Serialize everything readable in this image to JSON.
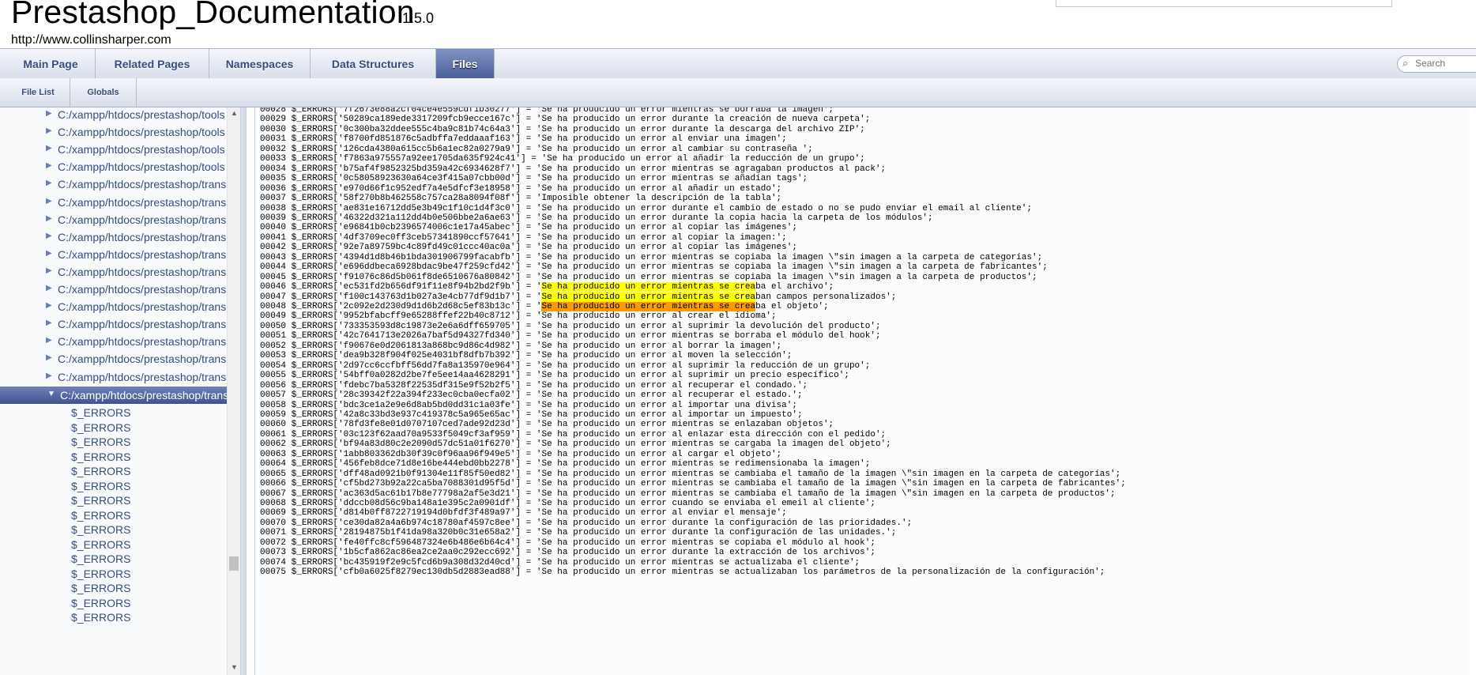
{
  "header": {
    "project_name": "Prestashop_Documentation",
    "project_number": "1.5.0",
    "project_brief": "http://www.collinsharper.com"
  },
  "tabs": [
    {
      "label": "Main Page",
      "current": false
    },
    {
      "label": "Related Pages",
      "current": false
    },
    {
      "label": "Namespaces",
      "current": false
    },
    {
      "label": "Data Structures",
      "current": false
    },
    {
      "label": "Files",
      "current": true
    }
  ],
  "subtabs": [
    {
      "label": "File List"
    },
    {
      "label": "Globals"
    }
  ],
  "search": {
    "placeholder": "Search",
    "icon": "magnifier-icon"
  },
  "tree": {
    "paths": [
      "C:/xampp/htdocs/prestashop/tools",
      "C:/xampp/htdocs/prestashop/tools",
      "C:/xampp/htdocs/prestashop/tools",
      "C:/xampp/htdocs/prestashop/tools",
      "C:/xampp/htdocs/prestashop/translations",
      "C:/xampp/htdocs/prestashop/translations",
      "C:/xampp/htdocs/prestashop/translations",
      "C:/xampp/htdocs/prestashop/translations",
      "C:/xampp/htdocs/prestashop/translations",
      "C:/xampp/htdocs/prestashop/translations",
      "C:/xampp/htdocs/prestashop/translations",
      "C:/xampp/htdocs/prestashop/translations",
      "C:/xampp/htdocs/prestashop/translations",
      "C:/xampp/htdocs/prestashop/translations",
      "C:/xampp/htdocs/prestashop/translations",
      "C:/xampp/htdocs/prestashop/translations"
    ],
    "selected": "C:/xampp/htdocs/prestashop/translations",
    "leaves": [
      "$_ERRORS",
      "$_ERRORS",
      "$_ERRORS",
      "$_ERRORS",
      "$_ERRORS",
      "$_ERRORS",
      "$_ERRORS",
      "$_ERRORS",
      "$_ERRORS",
      "$_ERRORS",
      "$_ERRORS",
      "$_ERRORS",
      "$_ERRORS",
      "$_ERRORS",
      "$_ERRORS"
    ]
  },
  "highlight_text": "Se ha producido un error mientras se crea",
  "code": [
    {
      "n": "00028",
      "key": "7f2673e88a2cf04ce4e559cdf1b30277",
      "msg": "Se ha producido un error mientras se borraba la imagen"
    },
    {
      "n": "00029",
      "key": "50289ca189ede3317209fcb9ecce167c",
      "msg": "Se ha producido un error durante la creación de nueva carpeta"
    },
    {
      "n": "00030",
      "key": "0c300ba32ddee555c4ba9c81b74c64a3",
      "msg": "Se ha producido un error durante la descarga del archivo ZIP"
    },
    {
      "n": "00031",
      "key": "f8700fd851876c5adbffa7eddaaaf163",
      "msg": "Se ha producido un error al enviar una imagen"
    },
    {
      "n": "00032",
      "key": "126cda4380a615cc5b6a1ec82a0279a9",
      "msg": "Se ha producido un error al cambiar su contraseña "
    },
    {
      "n": "00033",
      "key": "f7863a975557a92ee1705da635f924c41",
      "msg": "Se ha producido un error al añadir la reducción de un grupo"
    },
    {
      "n": "00034",
      "key": "b75af4f9852325bd359a42c6934628f7",
      "msg": "Se ha producido un error mientras se agragaban productos al pack"
    },
    {
      "n": "00035",
      "key": "0c58058923630a64ce3f415a07cbb00d",
      "msg": "Se ha producido un error mientras se añadían tags"
    },
    {
      "n": "00036",
      "key": "e970d66f1c952edf7a4e5dfcf3e18958",
      "msg": "Se ha producido un error al añadir un estado"
    },
    {
      "n": "00037",
      "key": "58f270b8b462558c757ca28a8094f08f",
      "msg": "Imposible obtener la descripción de la tabla"
    },
    {
      "n": "00038",
      "key": "ae831e16712dd5e3b49c1f10c1d4f3c0",
      "msg": "Se ha producido un error durante el cambio de estado o no se pudo enviar el email al cliente"
    },
    {
      "n": "00039",
      "key": "46322d321a112dd4b0e506bbe2a6ae63",
      "msg": "Se ha producido un error durante la copia hacia la carpeta de los módulos"
    },
    {
      "n": "00040",
      "key": "e96841b0cb2396574006c1e17a45abec",
      "msg": "Se ha producido un error al copiar las imágenes"
    },
    {
      "n": "00041",
      "key": "4df3709ec0ff3ceb57341890ccf57641",
      "msg": "Se ha producido un error al copiar la imagen:"
    },
    {
      "n": "00042",
      "key": "92e7a89759bc4c89fd49c01ccc40ac0a",
      "msg": "Se ha producido un error al copiar las imágenes"
    },
    {
      "n": "00043",
      "key": "4394d1d8b46b1bda301906799facabfb",
      "msg": "Se ha producido un error mientras se copiaba la imagen \\\"sin imagen a la carpeta de categorías"
    },
    {
      "n": "00044",
      "key": "e696ddbeca6928bdac9be47f259cfd42",
      "msg": "Se ha producido un error mientras se copiaba la imagen \\\"sin imagen a la carpeta de fabricantes"
    },
    {
      "n": "00045",
      "key": "f91076c86d5b061f8de6510676a80842",
      "msg": "Se ha producido un error mientras se copiaba la imagen \\\"sin imagen a la carpeta de productos"
    },
    {
      "n": "00046",
      "key": "ec531fd2b656df91f11e8f94b2bd2f9b",
      "msg": "Se ha producido un error mientras se creaba el archivo",
      "hl": "y"
    },
    {
      "n": "00047",
      "key": "f100c143763d1b027a3e4cb77df9d1b7",
      "msg": "Se ha producido un error mientras se creaban campos personalizados",
      "hl": "y"
    },
    {
      "n": "00048",
      "key": "2c092e2d230d9d1d6b2d68c5ef83b13c",
      "msg": "Se ha producido un error mientras se creaba el objeto",
      "hl": "o"
    },
    {
      "n": "00049",
      "key": "9952bfabcff9e65288ffef22b40c8712",
      "msg": "Se ha producido un error al crear el idioma"
    },
    {
      "n": "00050",
      "key": "733353593d8c19873e2e6a6dff659705",
      "msg": "Se ha producido un error al suprimir la devolución del producto"
    },
    {
      "n": "00051",
      "key": "42c7641713e2026a7baf5d94327fd340",
      "msg": "Se ha producido un error mientras se borraba el módulo del hook"
    },
    {
      "n": "00052",
      "key": "f90676e0d2061813a868bc9d86c4d982",
      "msg": "Se ha producido un error al borrar la imagen"
    },
    {
      "n": "00053",
      "key": "dea9b328f904f025e4031bf8dfb7b392",
      "msg": "Se ha producido un error al moven la selección"
    },
    {
      "n": "00054",
      "key": "2d97cc6ccfbff56dd7fa8a135970e964",
      "msg": "Se ha producido un error al suprimir la reducción de un grupo"
    },
    {
      "n": "00055",
      "key": "54bff0a0282d2be7fe5ee14aa4628291",
      "msg": "Se ha producido un error al suprimir un precio específico"
    },
    {
      "n": "00056",
      "key": "fdebc7ba5328f22535df315e9f52b2f5",
      "msg": "Se ha producido un error al recuperar el condado."
    },
    {
      "n": "00057",
      "key": "28c39342f22a394f233ec0cba0ecfa02",
      "msg": "Se ha producido un error al recuperar el estado."
    },
    {
      "n": "00058",
      "key": "bdc3ce1a2e9e6d8ab5bd0dd31c1a03fe",
      "msg": "Se ha producido un error al importar una divisa"
    },
    {
      "n": "00059",
      "key": "42a8c33bd3e937c419378c5a965e65ac",
      "msg": "Se ha producido un error al importar un impuesto"
    },
    {
      "n": "00060",
      "key": "78fd3fe8e01d0707107ced7ade92d23d",
      "msg": "Se ha producido un error mientras se enlazaban objetos"
    },
    {
      "n": "00061",
      "key": "03c123f62aad70a9533f5049cf3af959",
      "msg": "Se ha producido un error al enlazar esta dirección con el pedido"
    },
    {
      "n": "00062",
      "key": "bf94a83d80c2e2090d57dc51a01f6270",
      "msg": "Se ha producido un error mientras se cargaba la imagen del objeto"
    },
    {
      "n": "00063",
      "key": "1abb803362db30f39c0f96aa96f949e5",
      "msg": "Se ha producido un error al cargar el objeto"
    },
    {
      "n": "00064",
      "key": "456feb8dce71d8e16be444ebd0bb2278",
      "msg": "Se ha producido un error mientras se redimensionaba la imagen"
    },
    {
      "n": "00065",
      "key": "dff48ad0921b0f91304e11f85f50ed82",
      "msg": "Se ha producido un error mientras se cambiaba el tamaño de la imagen \\\"sin imagen en la carpeta de categorías"
    },
    {
      "n": "00066",
      "key": "cf5bd273b92a22ca5ba7088301d95f5d",
      "msg": "Se ha producido un error mientras se cambiaba el tamaño de la imagen \\\"sin imagen en la carpeta de fabricantes"
    },
    {
      "n": "00067",
      "key": "ac363d5ac61b17b8e77798a2af5e3d21",
      "msg": "Se ha producido un error mientras se cambiaba el tamaño de la imagen \\\"sin imagen en la carpeta de productos"
    },
    {
      "n": "00068",
      "key": "ddccb08d56c9ba148a1e395c2a0901df",
      "msg": "Se ha producido un error cuando se enviaba el emeil al cliente"
    },
    {
      "n": "00069",
      "key": "d814b0ff8722719194d0bfdf3f489a97",
      "msg": "Se ha producido un error al enviar el mensaje"
    },
    {
      "n": "00070",
      "key": "ce30da82a4a6b974c18780af4597c8ee",
      "msg": "Se ha producido un error durante la configuración de las prioridades."
    },
    {
      "n": "00071",
      "key": "28194875b1f41da98a320b0c31e658a2",
      "msg": "Se ha producido un error durante la configuración de las unidades."
    },
    {
      "n": "00072",
      "key": "fe40ffc8cf596487324e6b486e6b64c4",
      "msg": "Se ha producido un error mientras se copiaba el módulo al hook"
    },
    {
      "n": "00073",
      "key": "1b5cfa862ac86ea2ce2aa0c292ecc692",
      "msg": "Se ha producido un error durante la extracción de los archivos"
    },
    {
      "n": "00074",
      "key": "bc435919f2e9c5fcd6b9a308d32d40cd",
      "msg": "Se ha producido un error mientras se actualizaba el cliente"
    },
    {
      "n": "00075",
      "key": "cfb0a6025f8279ec130db5d2883ead88",
      "msg": "Se ha producido un error mientras se actualizaban los parámetros de la personalización de la configuración"
    }
  ]
}
